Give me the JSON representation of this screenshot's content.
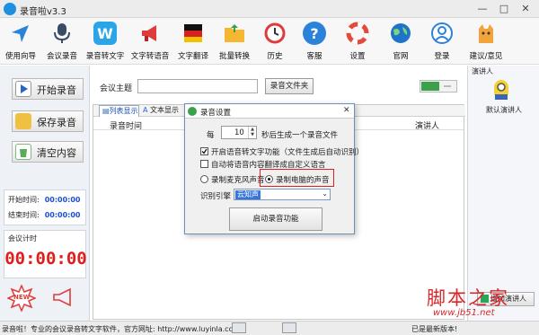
{
  "window": {
    "title": "录音啦v3.3",
    "minimize": "—",
    "maximize": "□",
    "close": "✕"
  },
  "toolbar": {
    "items": [
      {
        "label": "使用向导",
        "icon": "navigation-arrow-icon"
      },
      {
        "label": "会议录音",
        "icon": "microphone-icon"
      },
      {
        "label": "录音转文字",
        "icon": "w-letter-icon"
      },
      {
        "label": "文字转语音",
        "icon": "megaphone-icon"
      },
      {
        "label": "文字翻译",
        "icon": "flag-book-icon"
      },
      {
        "label": "批量转换",
        "icon": "folder-icon"
      },
      {
        "label": "历史",
        "icon": "clock-icon"
      },
      {
        "label": "客服",
        "icon": "help-icon"
      },
      {
        "label": "设置",
        "icon": "lifebuoy-icon"
      },
      {
        "label": "官网",
        "icon": "globe-icon"
      },
      {
        "label": "登录",
        "icon": "user-icon"
      },
      {
        "label": "建议/意见",
        "icon": "cat-icon"
      }
    ]
  },
  "left": {
    "start_label": "开始录音",
    "save_label": "保存录音",
    "clear_label": "清空内容",
    "start_time_label": "开始时间:",
    "start_time_value": "00:00:00",
    "end_time_label": "结束时间:",
    "end_time_value": "00:00:00",
    "meeting_timer_label": "会议计时",
    "meeting_timer_value": "00:00:00",
    "new_badge": "NEW"
  },
  "main": {
    "topic_label": "会议主题",
    "topic_value": "",
    "record_folder_button": "录音文件夹",
    "tabs": [
      "列表显示",
      "文本显示"
    ],
    "col_time": "录音时间",
    "col_speaker": "演讲人"
  },
  "right": {
    "speaker_header": "演讲人",
    "default_speaker": "默认演讲人",
    "add_speaker": "增加演讲人"
  },
  "dialog": {
    "title": "录音设置",
    "close": "✕",
    "every_label": "每",
    "interval_value": "10",
    "interval_suffix": "秒后生成一个录音文件",
    "option1": "开启语音转文字功能（文件生成后自动识别）",
    "option1_checked": true,
    "option2": "自动将语音内容翻译成自定义语言",
    "option2_checked": false,
    "radio_mic": "录制麦克风声音",
    "radio_pc": "录制电脑的声音",
    "selected_radio": "pc",
    "engine_label": "识别引擎",
    "engine_value": "云知声",
    "start_button": "启动录音功能"
  },
  "status": {
    "left_text": "录音啦！专业的会议录音转文字软件，官方网址: http://www.luyinla.com/",
    "right_text": "已是最新版本!"
  },
  "watermark": {
    "text": "脚本之家",
    "url": "www.jb51.net"
  },
  "colors": {
    "accent_blue": "#1a6fd4",
    "timer_red": "#e21b1b",
    "highlight_red": "#e02020",
    "toggle_green": "#3aa34a"
  }
}
